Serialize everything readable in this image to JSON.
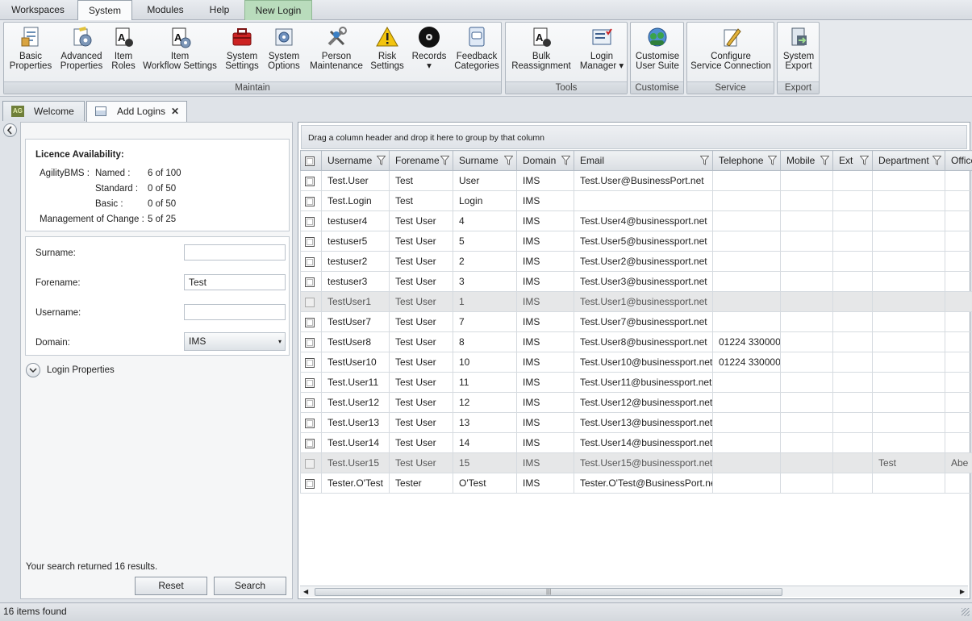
{
  "menu": {
    "tabs": [
      {
        "label": "Workspaces"
      },
      {
        "label": "System"
      },
      {
        "label": "Modules"
      },
      {
        "label": "Help"
      },
      {
        "label": "New Login"
      }
    ]
  },
  "ribbon": {
    "groups": [
      {
        "title": "Maintain",
        "buttons": [
          {
            "l1": "Basic",
            "l2": "Properties"
          },
          {
            "l1": "Advanced",
            "l2": "Properties"
          },
          {
            "l1": "Item",
            "l2": "Roles"
          },
          {
            "l1": "Item",
            "l2": "Workflow Settings"
          },
          {
            "l1": "System",
            "l2": "Settings"
          },
          {
            "l1": "System",
            "l2": "Options"
          },
          {
            "l1": "Person",
            "l2": "Maintenance"
          },
          {
            "l1": "Risk",
            "l2": "Settings"
          },
          {
            "l1": "Records",
            "l2": "▾"
          },
          {
            "l1": "Feedback",
            "l2": "Categories"
          }
        ]
      },
      {
        "title": "Tools",
        "buttons": [
          {
            "l1": "Bulk",
            "l2": "Reassignment"
          },
          {
            "l1": "Login",
            "l2": "Manager ▾"
          }
        ]
      },
      {
        "title": "Customise",
        "buttons": [
          {
            "l1": "Customise",
            "l2": "User Suite"
          }
        ]
      },
      {
        "title": "Service",
        "buttons": [
          {
            "l1": "Configure",
            "l2": "Service Connection"
          }
        ]
      },
      {
        "title": "Export",
        "buttons": [
          {
            "l1": "System",
            "l2": "Export"
          }
        ]
      }
    ]
  },
  "doctabs": {
    "welcome": "Welcome",
    "add_logins": "Add Logins",
    "close": "✕"
  },
  "licence": {
    "title": "Licence Availability:",
    "product": "AgilityBMS :",
    "rows": [
      {
        "label": "Named :",
        "value": "6 of 100"
      },
      {
        "label": "Standard :",
        "value": "0 of 50"
      },
      {
        "label": "Basic :",
        "value": "0 of 50"
      }
    ],
    "moc_label": "Management of Change :",
    "moc_value": "5 of 25"
  },
  "search": {
    "surname_label": "Surname:",
    "surname_value": "",
    "forename_label": "Forename:",
    "forename_value": "Test",
    "username_label": "Username:",
    "username_value": "",
    "domain_label": "Domain:",
    "domain_value": "IMS",
    "login_properties": "Login Properties",
    "result_text": "Your search returned 16 results.",
    "reset_label": "Reset",
    "search_label": "Search"
  },
  "grid": {
    "group_hint": "Drag a column header and drop it here to group by that column",
    "columns": [
      "Username",
      "Forename",
      "Surname",
      "Domain",
      "Email",
      "Telephone",
      "Mobile",
      "Ext",
      "Department",
      "Office"
    ],
    "rows": [
      {
        "cells": [
          "Test.User",
          "Test",
          "User",
          "IMS",
          "Test.User@BusinessPort.net",
          "",
          "",
          "",
          "",
          ""
        ],
        "disabled": false
      },
      {
        "cells": [
          "Test.Login",
          "Test",
          "Login",
          "IMS",
          "",
          "",
          "",
          "",
          "",
          ""
        ],
        "disabled": false
      },
      {
        "cells": [
          "testuser4",
          "Test User",
          "4",
          "IMS",
          "Test.User4@businessport.net",
          "",
          "",
          "",
          "",
          ""
        ],
        "disabled": false
      },
      {
        "cells": [
          "testuser5",
          "Test User",
          "5",
          "IMS",
          "Test.User5@businessport.net",
          "",
          "",
          "",
          "",
          ""
        ],
        "disabled": false
      },
      {
        "cells": [
          "testuser2",
          "Test User",
          "2",
          "IMS",
          "Test.User2@businessport.net",
          "",
          "",
          "",
          "",
          ""
        ],
        "disabled": false
      },
      {
        "cells": [
          "testuser3",
          "Test User",
          "3",
          "IMS",
          "Test.User3@businessport.net",
          "",
          "",
          "",
          "",
          ""
        ],
        "disabled": false
      },
      {
        "cells": [
          "TestUser1",
          "Test User",
          "1",
          "IMS",
          "Test.User1@businessport.net",
          "",
          "",
          "",
          "",
          ""
        ],
        "disabled": true
      },
      {
        "cells": [
          "TestUser7",
          "Test User",
          "7",
          "IMS",
          "Test.User7@businessport.net",
          "",
          "",
          "",
          "",
          ""
        ],
        "disabled": false
      },
      {
        "cells": [
          "TestUser8",
          "Test User",
          "8",
          "IMS",
          "Test.User8@businessport.net",
          "01224 330000",
          "",
          "",
          "",
          ""
        ],
        "disabled": false
      },
      {
        "cells": [
          "TestUser10",
          "Test User",
          "10",
          "IMS",
          "Test.User10@businessport.net",
          "01224 330000",
          "",
          "",
          "",
          ""
        ],
        "disabled": false
      },
      {
        "cells": [
          "Test.User11",
          "Test User",
          "11",
          "IMS",
          "Test.User11@businessport.net",
          "",
          "",
          "",
          "",
          ""
        ],
        "disabled": false
      },
      {
        "cells": [
          "Test.User12",
          "Test User",
          "12",
          "IMS",
          "Test.User12@businessport.net",
          "",
          "",
          "",
          "",
          ""
        ],
        "disabled": false
      },
      {
        "cells": [
          "Test.User13",
          "Test User",
          "13",
          "IMS",
          "Test.User13@businessport.net",
          "",
          "",
          "",
          "",
          ""
        ],
        "disabled": false
      },
      {
        "cells": [
          "Test.User14",
          "Test User",
          "14",
          "IMS",
          "Test.User14@businessport.net",
          "",
          "",
          "",
          "",
          ""
        ],
        "disabled": false
      },
      {
        "cells": [
          "Test.User15",
          "Test User",
          "15",
          "IMS",
          "Test.User15@businessport.net",
          "",
          "",
          "",
          "Test",
          "Abe"
        ],
        "disabled": true
      },
      {
        "cells": [
          "Tester.O'Test",
          "Tester",
          "O'Test",
          "IMS",
          "Tester.O'Test@BusinessPort.net",
          "",
          "",
          "",
          "",
          ""
        ],
        "disabled": false
      }
    ]
  },
  "status": {
    "text": "16 items found"
  }
}
